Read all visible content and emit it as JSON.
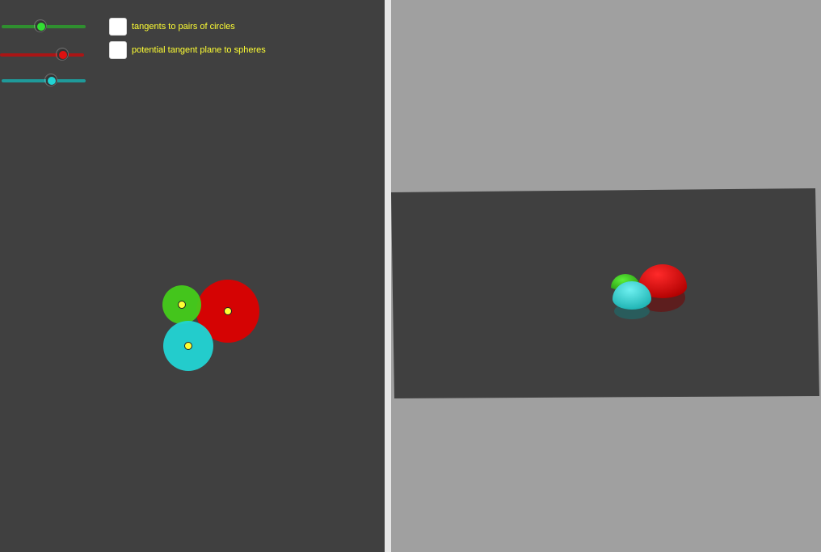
{
  "colors": {
    "panel_2d_bg": "#404040",
    "panel_3d_bg": "#a0a0a0",
    "plane": "#404040",
    "green": "#44cc1a",
    "red": "#dd0000",
    "cyan": "#22d4d4",
    "point": "#ffff33",
    "label": "#ffff33"
  },
  "sliders": [
    {
      "name": "green-radius-slider",
      "color": "#2f8f2f",
      "knob_color": "#33dd33",
      "value": 0.47
    },
    {
      "name": "red-radius-slider",
      "color": "#aa1515",
      "knob_color": "#dd1111",
      "value": 0.74
    },
    {
      "name": "cyan-radius-slider",
      "color": "#1f9a9a",
      "knob_color": "#22d4d4",
      "value": 0.59
    }
  ],
  "checkboxes": [
    {
      "label": "tangents to pairs of circles",
      "checked": false
    },
    {
      "label": "potential tangent plane to spheres",
      "checked": false
    }
  ],
  "circles": [
    "green",
    "red",
    "cyan"
  ],
  "spheres": [
    "green",
    "red",
    "cyan"
  ]
}
